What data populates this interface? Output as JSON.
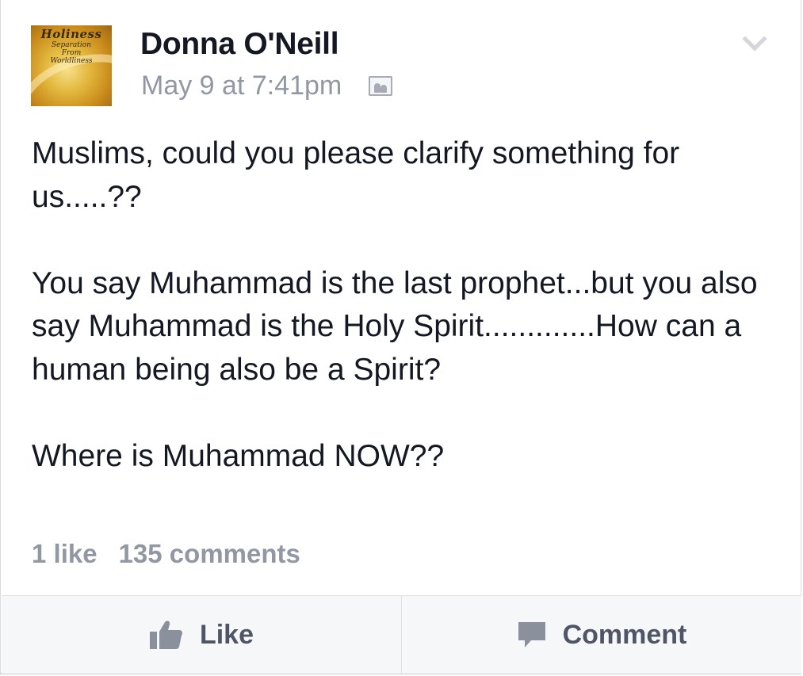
{
  "post": {
    "author": "Donna O'Neill",
    "timestamp": "May 9 at 7:41pm",
    "privacy_icon": "friends-icon",
    "avatar": {
      "line1": "Holiness",
      "line2": "Separation",
      "line3": "From",
      "line4": "Worldliness"
    },
    "body": "Muslims, could you please clarify something for us.....??\n\nYou say Muhammad is the last prophet...but you also say Muhammad is the Holy Spirit.............How can a human being also be a Spirit?\n\nWhere is Muhammad NOW??",
    "likes": "1 like",
    "comments": "135 comments"
  },
  "actions": {
    "like_label": "Like",
    "comment_label": "Comment"
  },
  "colors": {
    "text": "#141823",
    "muted": "#9197a3",
    "action": "#4e5665"
  }
}
